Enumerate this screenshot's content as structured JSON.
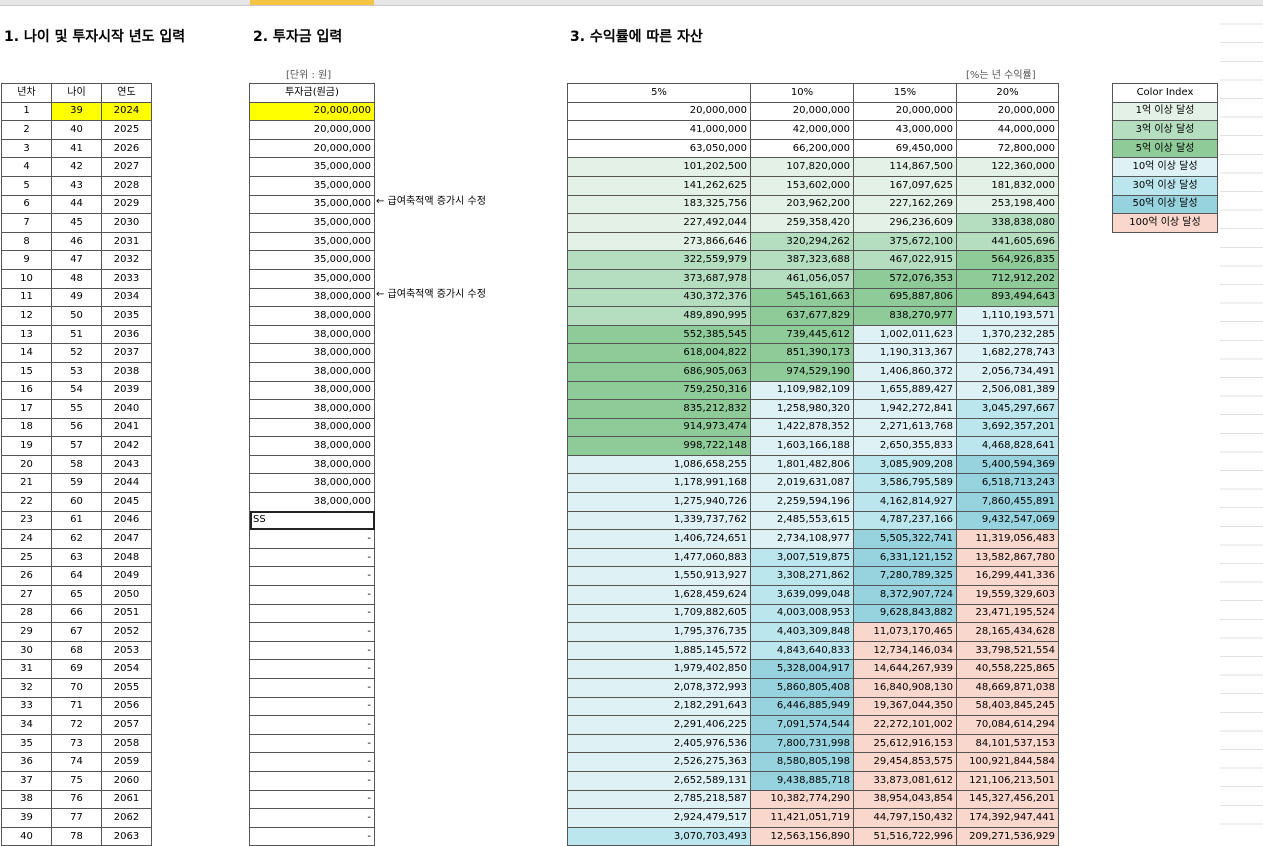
{
  "titles": {
    "s1": "1. 나이 및 투자시작 년도 입력",
    "s2": "2. 투자금 입력",
    "s3": "3. 수익률에 따른 자산"
  },
  "unit_note": "[단위 : 원]",
  "rate_note": "[%는 년 수익률]",
  "table1": {
    "headers": [
      "년차",
      "나이",
      "연도"
    ],
    "rows": [
      [
        "1",
        "39",
        "2024"
      ],
      [
        "2",
        "40",
        "2025"
      ],
      [
        "3",
        "41",
        "2026"
      ],
      [
        "4",
        "42",
        "2027"
      ],
      [
        "5",
        "43",
        "2028"
      ],
      [
        "6",
        "44",
        "2029"
      ],
      [
        "7",
        "45",
        "2030"
      ],
      [
        "8",
        "46",
        "2031"
      ],
      [
        "9",
        "47",
        "2032"
      ],
      [
        "10",
        "48",
        "2033"
      ],
      [
        "11",
        "49",
        "2034"
      ],
      [
        "12",
        "50",
        "2035"
      ],
      [
        "13",
        "51",
        "2036"
      ],
      [
        "14",
        "52",
        "2037"
      ],
      [
        "15",
        "53",
        "2038"
      ],
      [
        "16",
        "54",
        "2039"
      ],
      [
        "17",
        "55",
        "2040"
      ],
      [
        "18",
        "56",
        "2041"
      ],
      [
        "19",
        "57",
        "2042"
      ],
      [
        "20",
        "58",
        "2043"
      ],
      [
        "21",
        "59",
        "2044"
      ],
      [
        "22",
        "60",
        "2045"
      ],
      [
        "23",
        "61",
        "2046"
      ],
      [
        "24",
        "62",
        "2047"
      ],
      [
        "25",
        "63",
        "2048"
      ],
      [
        "26",
        "64",
        "2049"
      ],
      [
        "27",
        "65",
        "2050"
      ],
      [
        "28",
        "66",
        "2051"
      ],
      [
        "29",
        "67",
        "2052"
      ],
      [
        "30",
        "68",
        "2053"
      ],
      [
        "31",
        "69",
        "2054"
      ],
      [
        "32",
        "70",
        "2055"
      ],
      [
        "33",
        "71",
        "2056"
      ],
      [
        "34",
        "72",
        "2057"
      ],
      [
        "35",
        "73",
        "2058"
      ],
      [
        "36",
        "74",
        "2059"
      ],
      [
        "37",
        "75",
        "2060"
      ],
      [
        "38",
        "76",
        "2061"
      ],
      [
        "39",
        "77",
        "2062"
      ],
      [
        "40",
        "78",
        "2063"
      ]
    ]
  },
  "table2": {
    "header": "투자금(원금)",
    "values": [
      "20,000,000",
      "20,000,000",
      "20,000,000",
      "35,000,000",
      "35,000,000",
      "35,000,000",
      "35,000,000",
      "35,000,000",
      "35,000,000",
      "35,000,000",
      "38,000,000",
      "38,000,000",
      "38,000,000",
      "38,000,000",
      "38,000,000",
      "38,000,000",
      "38,000,000",
      "38,000,000",
      "38,000,000",
      "38,000,000",
      "38,000,000",
      "38,000,000",
      "SS",
      "-",
      "-",
      "-",
      "-",
      "-",
      "-",
      "-",
      "-",
      "-",
      "-",
      "-",
      "-",
      "-",
      "-",
      "-",
      "-",
      "-"
    ]
  },
  "notes": [
    "← 급여축적액 증가시 수정",
    "← 급여축적액 증가시 수정"
  ],
  "table3": {
    "headers": [
      "5%",
      "10%",
      "15%",
      "20%"
    ],
    "rows": [
      [
        "20,000,000",
        "20,000,000",
        "20,000,000",
        "20,000,000"
      ],
      [
        "41,000,000",
        "42,000,000",
        "43,000,000",
        "44,000,000"
      ],
      [
        "63,050,000",
        "66,200,000",
        "69,450,000",
        "72,800,000"
      ],
      [
        "101,202,500",
        "107,820,000",
        "114,867,500",
        "122,360,000"
      ],
      [
        "141,262,625",
        "153,602,000",
        "167,097,625",
        "181,832,000"
      ],
      [
        "183,325,756",
        "203,962,200",
        "227,162,269",
        "253,198,400"
      ],
      [
        "227,492,044",
        "259,358,420",
        "296,236,609",
        "338,838,080"
      ],
      [
        "273,866,646",
        "320,294,262",
        "375,672,100",
        "441,605,696"
      ],
      [
        "322,559,979",
        "387,323,688",
        "467,022,915",
        "564,926,835"
      ],
      [
        "373,687,978",
        "461,056,057",
        "572,076,353",
        "712,912,202"
      ],
      [
        "430,372,376",
        "545,161,663",
        "695,887,806",
        "893,494,643"
      ],
      [
        "489,890,995",
        "637,677,829",
        "838,270,977",
        "1,110,193,571"
      ],
      [
        "552,385,545",
        "739,445,612",
        "1,002,011,623",
        "1,370,232,285"
      ],
      [
        "618,004,822",
        "851,390,173",
        "1,190,313,367",
        "1,682,278,743"
      ],
      [
        "686,905,063",
        "974,529,190",
        "1,406,860,372",
        "2,056,734,491"
      ],
      [
        "759,250,316",
        "1,109,982,109",
        "1,655,889,427",
        "2,506,081,389"
      ],
      [
        "835,212,832",
        "1,258,980,320",
        "1,942,272,841",
        "3,045,297,667"
      ],
      [
        "914,973,474",
        "1,422,878,352",
        "2,271,613,768",
        "3,692,357,201"
      ],
      [
        "998,722,148",
        "1,603,166,188",
        "2,650,355,833",
        "4,468,828,641"
      ],
      [
        "1,086,658,255",
        "1,801,482,806",
        "3,085,909,208",
        "5,400,594,369"
      ],
      [
        "1,178,991,168",
        "2,019,631,087",
        "3,586,795,589",
        "6,518,713,243"
      ],
      [
        "1,275,940,726",
        "2,259,594,196",
        "4,162,814,927",
        "7,860,455,891"
      ],
      [
        "1,339,737,762",
        "2,485,553,615",
        "4,787,237,166",
        "9,432,547,069"
      ],
      [
        "1,406,724,651",
        "2,734,108,977",
        "5,505,322,741",
        "11,319,056,483"
      ],
      [
        "1,477,060,883",
        "3,007,519,875",
        "6,331,121,152",
        "13,582,867,780"
      ],
      [
        "1,550,913,927",
        "3,308,271,862",
        "7,280,789,325",
        "16,299,441,336"
      ],
      [
        "1,628,459,624",
        "3,639,099,048",
        "8,372,907,724",
        "19,559,329,603"
      ],
      [
        "1,709,882,605",
        "4,003,008,953",
        "9,628,843,882",
        "23,471,195,524"
      ],
      [
        "1,795,376,735",
        "4,403,309,848",
        "11,073,170,465",
        "28,165,434,628"
      ],
      [
        "1,885,145,572",
        "4,843,640,833",
        "12,734,146,034",
        "33,798,521,554"
      ],
      [
        "1,979,402,850",
        "5,328,004,917",
        "14,644,267,939",
        "40,558,225,865"
      ],
      [
        "2,078,372,993",
        "5,860,805,408",
        "16,840,908,130",
        "48,669,871,038"
      ],
      [
        "2,182,291,643",
        "6,446,885,949",
        "19,367,044,350",
        "58,403,845,245"
      ],
      [
        "2,291,406,225",
        "7,091,574,544",
        "22,272,101,002",
        "70,084,614,294"
      ],
      [
        "2,405,976,536",
        "7,800,731,998",
        "25,612,916,153",
        "84,101,537,153"
      ],
      [
        "2,526,275,363",
        "8,580,805,198",
        "29,454,853,575",
        "100,921,844,584"
      ],
      [
        "2,652,589,131",
        "9,438,885,718",
        "33,873,081,612",
        "121,106,213,501"
      ],
      [
        "2,785,218,587",
        "10,382,774,290",
        "38,954,043,854",
        "145,327,456,201"
      ],
      [
        "2,924,479,517",
        "11,421,051,719",
        "44,797,150,432",
        "174,392,947,441"
      ],
      [
        "3,070,703,493",
        "12,563,156,890",
        "51,516,722,996",
        "209,271,536,929"
      ]
    ]
  },
  "legend": {
    "title": "Color Index",
    "items": [
      {
        "label": "1억 이상 달성",
        "color": "#e3f1e6"
      },
      {
        "label": "3억 이상 달성",
        "color": "#b5ddbf"
      },
      {
        "label": "5억 이상 달성",
        "color": "#8fcb99"
      },
      {
        "label": "10억 이상 달성",
        "color": "#def1f5"
      },
      {
        "label": "30억 이상 달성",
        "color": "#bce6ee"
      },
      {
        "label": "50억 이상 달성",
        "color": "#97d3df"
      },
      {
        "label": "100억 이상 달성",
        "color": "#fad7cc"
      }
    ]
  }
}
